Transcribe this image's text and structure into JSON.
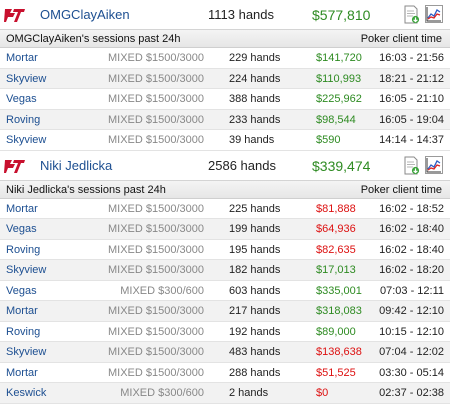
{
  "players": [
    {
      "name": "OMGClayAiken",
      "hands": "1113 hands",
      "profit": "$577,810",
      "sessions_title": "OMGClayAiken's sessions past 24h",
      "time_label": "Poker client time",
      "sessions": [
        {
          "table": "Mortar",
          "game": "MIXED $1500/3000",
          "hands": "229 hands",
          "profit": "$141,720",
          "time": "16:03 - 21:56"
        },
        {
          "table": "Skyview",
          "game": "MIXED $1500/3000",
          "hands": "224 hands",
          "profit": "$110,993",
          "time": "18:21 - 21:12"
        },
        {
          "table": "Vegas",
          "game": "MIXED $1500/3000",
          "hands": "388 hands",
          "profit": "$225,962",
          "time": "16:05 - 21:10"
        },
        {
          "table": "Roving",
          "game": "MIXED $1500/3000",
          "hands": "233 hands",
          "profit": "$98,544",
          "time": "16:05 - 19:04"
        },
        {
          "table": "Skyview",
          "game": "MIXED $1500/3000",
          "hands": "39 hands",
          "profit": "$590",
          "time": "14:14 - 14:37"
        }
      ]
    },
    {
      "name": "Niki Jedlicka",
      "hands": "2586 hands",
      "profit": "$339,474",
      "sessions_title": "Niki Jedlicka's sessions past 24h",
      "time_label": "Poker client time",
      "sessions": [
        {
          "table": "Mortar",
          "game": "MIXED $1500/3000",
          "hands": "225 hands",
          "profit": "$81,888",
          "time": "16:02 - 18:52"
        },
        {
          "table": "Vegas",
          "game": "MIXED $1500/3000",
          "hands": "199 hands",
          "profit": "$64,936",
          "time": "16:02 - 18:40"
        },
        {
          "table": "Roving",
          "game": "MIXED $1500/3000",
          "hands": "195 hands",
          "profit": "$82,635",
          "time": "16:02 - 18:40"
        },
        {
          "table": "Skyview",
          "game": "MIXED $1500/3000",
          "hands": "182 hands",
          "profit": "$17,013",
          "time": "16:02 - 18:20"
        },
        {
          "table": "Vegas",
          "game": "MIXED $300/600",
          "hands": "603 hands",
          "profit": "$335,001",
          "time": "07:03 - 12:11"
        },
        {
          "table": "Mortar",
          "game": "MIXED $1500/3000",
          "hands": "217 hands",
          "profit": "$318,083",
          "time": "09:42 - 12:10"
        },
        {
          "table": "Roving",
          "game": "MIXED $1500/3000",
          "hands": "192 hands",
          "profit": "$89,000",
          "time": "10:15 - 12:10"
        },
        {
          "table": "Skyview",
          "game": "MIXED $1500/3000",
          "hands": "483 hands",
          "profit": "$138,638",
          "time": "07:04 - 12:02"
        },
        {
          "table": "Mortar",
          "game": "MIXED $1500/3000",
          "hands": "288 hands",
          "profit": "$51,525",
          "time": "03:30 - 05:14"
        },
        {
          "table": "Keswick",
          "game": "MIXED $300/600",
          "hands": "2 hands",
          "profit": "$0",
          "time": "02:37 - 02:38"
        }
      ]
    }
  ],
  "profit_colors": {
    "positive": "#2e8b22",
    "negative": "#dd1111"
  },
  "icons": {
    "logo": "full-tilt-logo",
    "export": "export-document-icon",
    "graph": "graph-chart-icon"
  }
}
